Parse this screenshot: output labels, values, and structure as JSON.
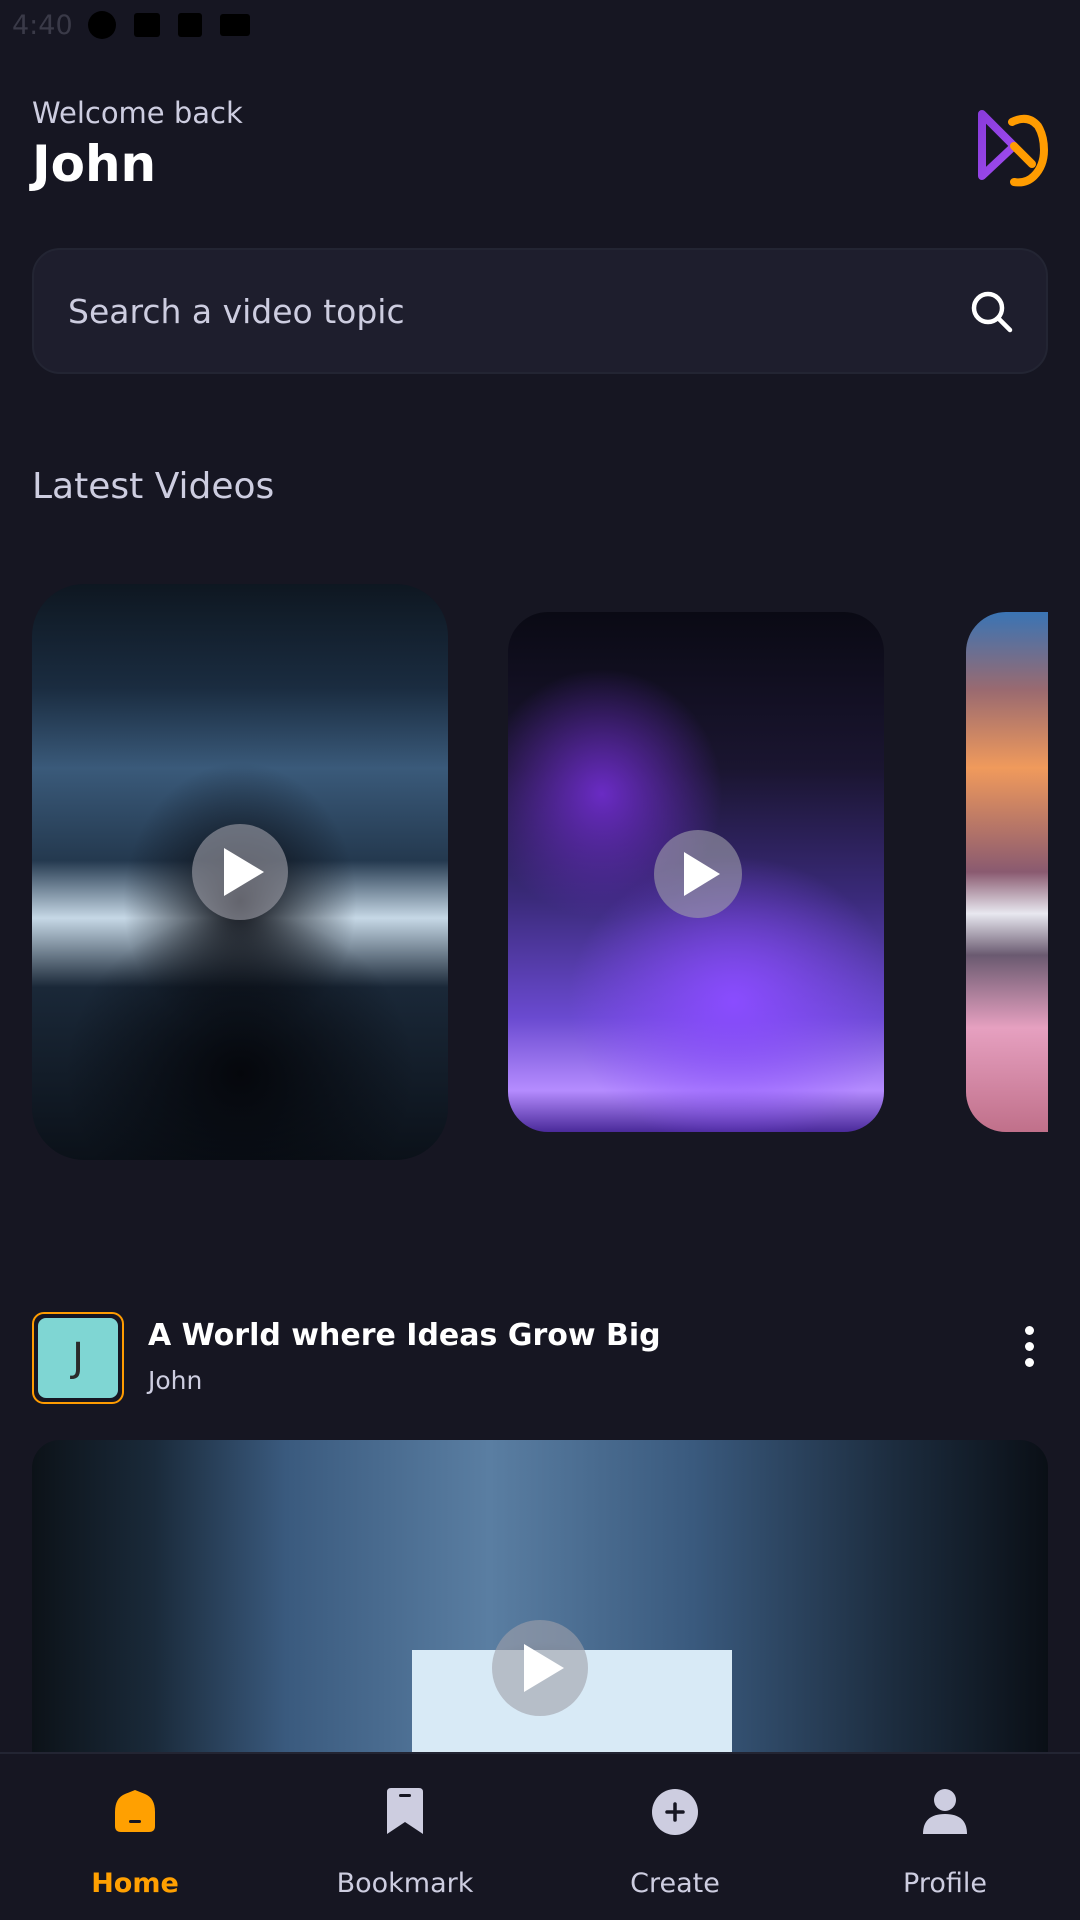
{
  "status_bar": {
    "time": "4:40"
  },
  "header": {
    "welcome": "Welcome back",
    "username": "John"
  },
  "search": {
    "placeholder": "Search a video topic"
  },
  "latest": {
    "title": "Latest Videos"
  },
  "post": {
    "avatar_letter": "J",
    "title": "A World where Ideas Grow Big",
    "author": "John"
  },
  "tabs": [
    {
      "label": "Home",
      "icon": "home-icon",
      "active": true
    },
    {
      "label": "Bookmark",
      "icon": "bookmark-icon",
      "active": false
    },
    {
      "label": "Create",
      "icon": "plus-icon",
      "active": false
    },
    {
      "label": "Profile",
      "icon": "profile-icon",
      "active": false
    }
  ],
  "colors": {
    "background": "#161622",
    "accent": "#FFA001",
    "muted_text": "#CDCDE0",
    "surface": "#1E1E2D"
  }
}
